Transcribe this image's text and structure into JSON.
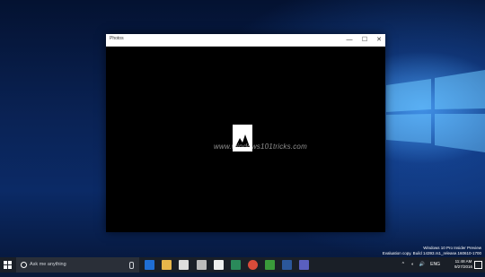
{
  "window": {
    "title": "Photos",
    "controls": {
      "minimize": "—",
      "maximize": "☐",
      "close": "✕"
    },
    "watermark": "www.windows101tricks.com"
  },
  "system": {
    "eval_line1": "Windows 10 Pro Insider Preview",
    "eval_line2": "Evaluation copy. Build 14393.rs1_release.160610-1700"
  },
  "taskbar": {
    "search_placeholder": "Ask me anything",
    "apps": [
      "edge-icon",
      "file-explorer-icon",
      "store-icon",
      "media-icon",
      "terminal-icon",
      "photos-icon",
      "chrome-icon",
      "gaming-icon",
      "word-icon",
      "app-icon"
    ],
    "clock_time": "11:48 AM",
    "clock_date": "9/27/2016",
    "tray_chevron": "^",
    "tray_volume": "🔊",
    "tray_network": "◐",
    "language": "ENG"
  }
}
